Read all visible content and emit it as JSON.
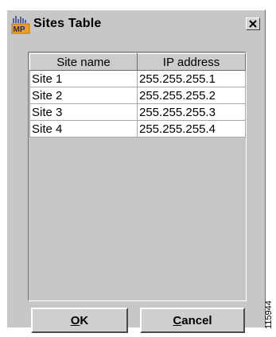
{
  "window": {
    "title": "Sites Table",
    "icon_name": "mp-app-icon",
    "close_icon": "close-icon"
  },
  "table": {
    "columns": [
      "Site name",
      "IP address"
    ],
    "rows": [
      [
        "Site 1",
        "255.255.255.1"
      ],
      [
        "Site 2",
        "255.255.255.2"
      ],
      [
        "Site 3",
        "255.255.255.3"
      ],
      [
        "Site 4",
        "255.255.255.4"
      ]
    ]
  },
  "buttons": {
    "ok": {
      "mnemonic": "O",
      "rest": "K"
    },
    "cancel": {
      "mnemonic": "C",
      "rest": "ancel"
    }
  },
  "watermark": "115944",
  "colors": {
    "dialog_bg": "#c7c7c7",
    "cell_bg": "#ffffff",
    "icon_orange": "#f0a020"
  }
}
